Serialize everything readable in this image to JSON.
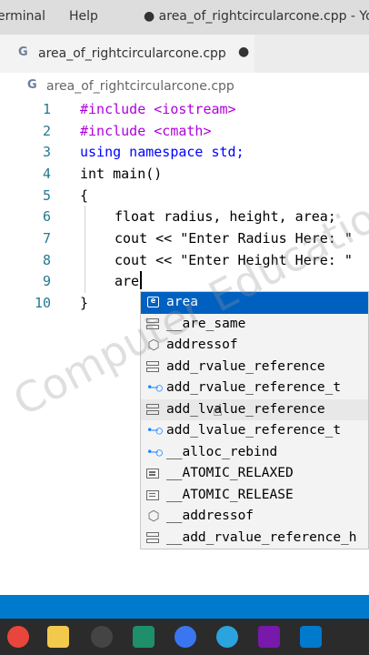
{
  "titlebar": {
    "menu_terminal": "erminal",
    "menu_help": "Help",
    "window_title": "● area_of_rightcircularcone.cpp - You"
  },
  "tab": {
    "name": "area_of_rightcircularcone.cpp",
    "modified_dot": "●"
  },
  "breadcrumb": {
    "file": "area_of_rightcircularcone.cpp"
  },
  "editor": {
    "lines": [
      {
        "num": "1",
        "text": "#include <iostream>"
      },
      {
        "num": "2",
        "text": "#include <cmath>"
      },
      {
        "num": "3",
        "text": "using namespace std;"
      },
      {
        "num": "4",
        "text": "int main()"
      },
      {
        "num": "5",
        "text": "{"
      },
      {
        "num": "6",
        "text": "float radius, height, area;"
      },
      {
        "num": "7",
        "text": "cout << \"Enter Radius Here: \""
      },
      {
        "num": "8",
        "text": "cout << \"Enter Height Here: \""
      },
      {
        "num": "9",
        "text": "are"
      },
      {
        "num": "10",
        "text": "}"
      }
    ]
  },
  "suggestions": [
    {
      "label": "area",
      "icon": "variable-icon"
    },
    {
      "label": "__are_same",
      "icon": "struct-icon"
    },
    {
      "label": "addressof",
      "icon": "class-icon"
    },
    {
      "label": "add_rvalue_reference",
      "icon": "struct-icon"
    },
    {
      "label": "add_rvalue_reference_t",
      "icon": "type-parameter-icon"
    },
    {
      "label": "add_lvalue_reference",
      "icon": "struct-icon"
    },
    {
      "label": "add_lvalue_reference_t",
      "icon": "type-parameter-icon"
    },
    {
      "label": "__alloc_rebind",
      "icon": "type-parameter-icon"
    },
    {
      "label": "__ATOMIC_RELAXED",
      "icon": "enum-icon"
    },
    {
      "label": "__ATOMIC_RELEASE",
      "icon": "enum-icon"
    },
    {
      "label": "__addressof",
      "icon": "class-icon"
    },
    {
      "label": "__add_rvalue_reference_h",
      "icon": "struct-icon"
    }
  ],
  "watermark": "Computer Education",
  "colors": {
    "keyword": "#0000ff",
    "preprocessor": "#af00db",
    "string": "#a31515",
    "selection": "#0060c0",
    "statusbar": "#007acc"
  },
  "taskbar": [
    {
      "icon": "chrome-icon",
      "color": "#e8453c"
    },
    {
      "icon": "file-explorer-icon",
      "color": "#f2c94c"
    },
    {
      "icon": "obs-icon",
      "color": "#444444"
    },
    {
      "icon": "app-icon",
      "color": "#1e8f6a"
    },
    {
      "icon": "signal-icon",
      "color": "#3a76f0"
    },
    {
      "icon": "telegram-icon",
      "color": "#2aa3df"
    },
    {
      "icon": "onenote-icon",
      "color": "#7719aa"
    },
    {
      "icon": "vscode-icon",
      "color": "#007acc"
    }
  ]
}
